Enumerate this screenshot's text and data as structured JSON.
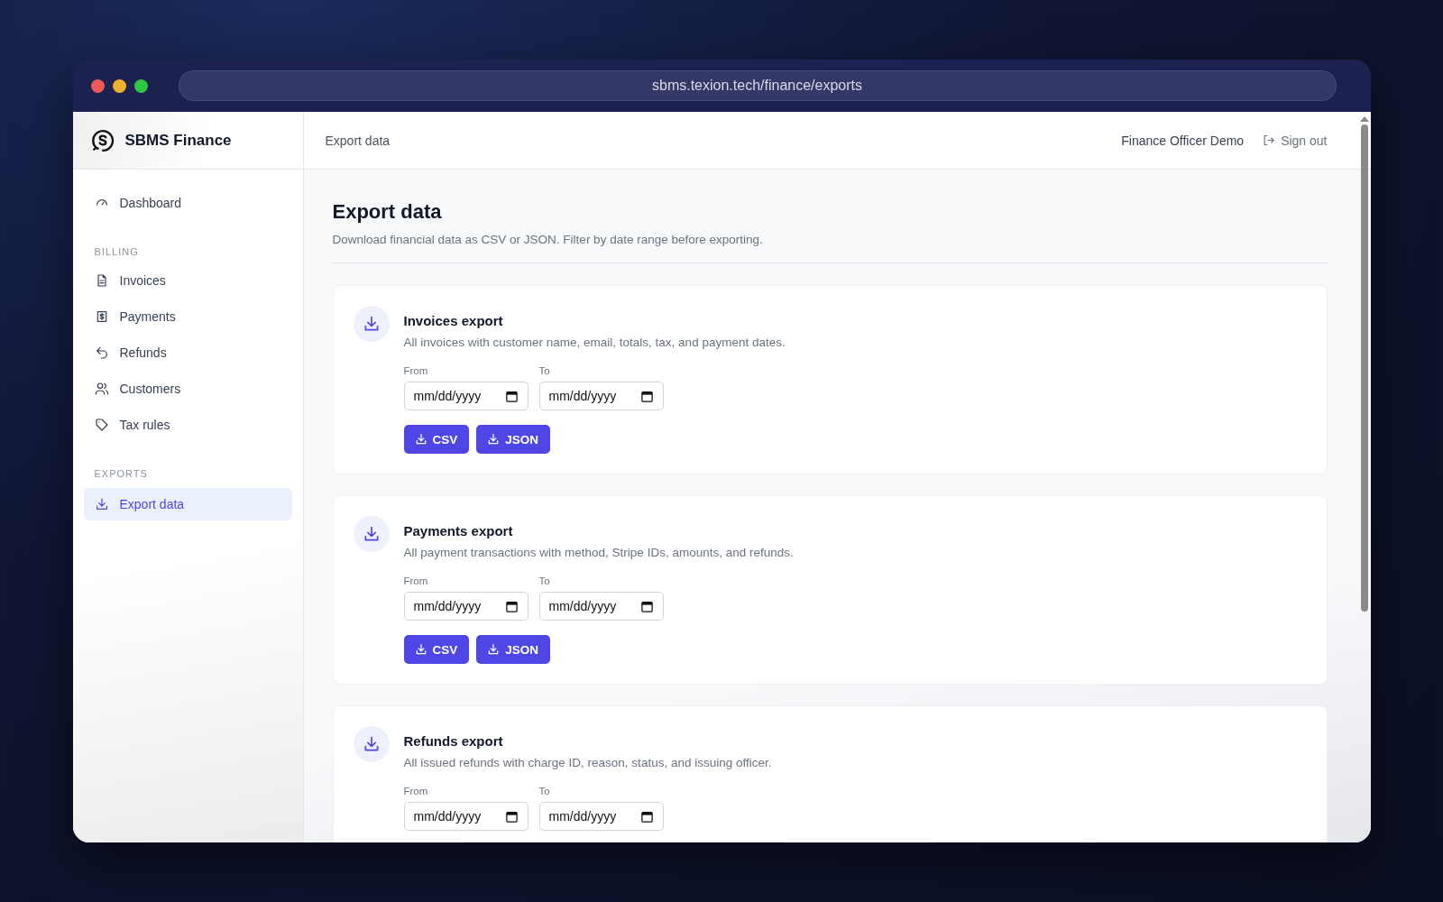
{
  "browser": {
    "url": "sbms.texion.tech/finance/exports"
  },
  "sidebar": {
    "brand": "SBMS Finance",
    "sections": [
      {
        "items": [
          {
            "label": "Dashboard",
            "selected": false
          }
        ]
      },
      {
        "heading": "BILLING",
        "items": [
          {
            "label": "Invoices",
            "selected": false
          },
          {
            "label": "Payments",
            "selected": false
          },
          {
            "label": "Refunds",
            "selected": false
          },
          {
            "label": "Customers",
            "selected": false
          },
          {
            "label": "Tax rules",
            "selected": false
          }
        ]
      },
      {
        "heading": "EXPORTS",
        "items": [
          {
            "label": "Export data",
            "selected": true
          }
        ]
      }
    ]
  },
  "header": {
    "breadcrumb": "Export data",
    "user": "Finance Officer Demo",
    "sign_out": "Sign out"
  },
  "page": {
    "title": "Export data",
    "subtitle": "Download financial data as CSV or JSON. Filter by date range before exporting.",
    "cards": [
      {
        "title": "Invoices export",
        "description": "All invoices with customer name, email, totals, tax, and payment dates.",
        "fields": [
          {
            "label": "From",
            "placeholder": "mm/dd/yyyy"
          },
          {
            "label": "To",
            "placeholder": "mm/dd/yyyy"
          }
        ],
        "buttons": [
          "CSV",
          "JSON"
        ]
      },
      {
        "title": "Payments export",
        "description": "All payment transactions with method, Stripe IDs, amounts, and refunds.",
        "fields": [
          {
            "label": "From",
            "placeholder": "mm/dd/yyyy"
          },
          {
            "label": "To",
            "placeholder": "mm/dd/yyyy"
          }
        ],
        "buttons": [
          "CSV",
          "JSON"
        ]
      },
      {
        "title": "Refunds export",
        "description": "All issued refunds with charge ID, reason, status, and issuing officer.",
        "fields": [
          {
            "label": "From",
            "placeholder": "mm/dd/yyyy"
          },
          {
            "label": "To",
            "placeholder": "mm/dd/yyyy"
          }
        ]
      }
    ]
  }
}
